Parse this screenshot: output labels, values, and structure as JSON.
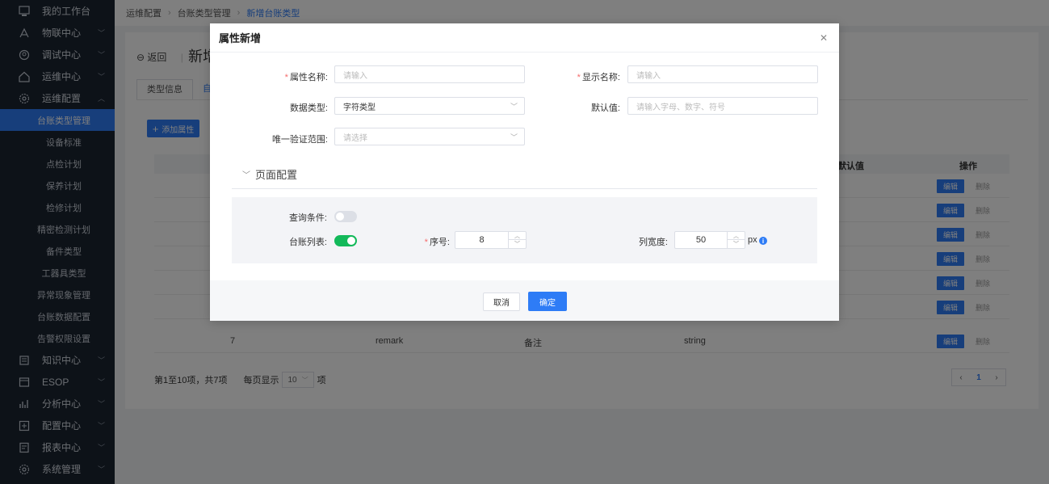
{
  "sidebar": {
    "groups_top": [
      {
        "label": "我的工作台",
        "icon": "monitor-icon",
        "chevron": false
      },
      {
        "label": "物联中心",
        "icon": "signal-icon",
        "chevron": true
      },
      {
        "label": "调试中心",
        "icon": "debug-icon",
        "chevron": true
      },
      {
        "label": "运维中心",
        "icon": "home-icon",
        "chevron": true
      },
      {
        "label": "运维配置",
        "icon": "gear-icon",
        "chevron": true,
        "expanded": true
      }
    ],
    "sub_items": [
      {
        "label": "台账类型管理",
        "active": true
      },
      {
        "label": "设备标准"
      },
      {
        "label": "点检计划"
      },
      {
        "label": "保养计划"
      },
      {
        "label": "检修计划"
      },
      {
        "label": "精密检测计划"
      },
      {
        "label": "备件类型"
      },
      {
        "label": "工器具类型"
      },
      {
        "label": "异常现象管理"
      },
      {
        "label": "台账数据配置"
      },
      {
        "label": "告警权限设置"
      }
    ],
    "groups_bottom": [
      {
        "label": "知识中心",
        "icon": "book-icon"
      },
      {
        "label": "ESOP",
        "icon": "esop-icon"
      },
      {
        "label": "分析中心",
        "icon": "chart-icon"
      },
      {
        "label": "配置中心",
        "icon": "config-icon"
      },
      {
        "label": "报表中心",
        "icon": "report-icon"
      },
      {
        "label": "系统管理",
        "icon": "settings-icon"
      }
    ]
  },
  "breadcrumb": [
    "运维配置",
    "台账类型管理",
    "新增台账类型"
  ],
  "page": {
    "back_label": "返回",
    "title_partial": "新增",
    "tabs": [
      "类型信息",
      "自"
    ],
    "add_button": "添加属性",
    "table_headers": {
      "default": "默认值",
      "ops": "操作"
    },
    "visible_row": {
      "index": "7",
      "code": "remark",
      "name": "备注",
      "type": "string"
    },
    "op_edit": "编辑",
    "op_delete": "删除",
    "footer_text": "第1至10项，共7项",
    "page_size_label": "每页显示",
    "page_size": "10",
    "page_size_unit": "项",
    "current_page": "1"
  },
  "modal": {
    "title": "属性新增",
    "fields": {
      "attr_name": {
        "label": "属性名称:",
        "placeholder": "请输入",
        "required": true
      },
      "display_name": {
        "label": "显示名称:",
        "placeholder": "请输入",
        "required": true
      },
      "data_type": {
        "label": "数据类型:",
        "value": "字符类型"
      },
      "default_value": {
        "label": "默认值:",
        "placeholder": "请输入字母、数字、符号"
      },
      "unique_scope": {
        "label": "唯一验证范围:",
        "placeholder": "请选择"
      }
    },
    "section": "页面配置",
    "config": {
      "query_label": "查询条件:",
      "query_on": false,
      "list_label": "台账列表:",
      "list_on": true,
      "order_label": "序号:",
      "order_value": "8",
      "width_label": "列宽度:",
      "width_value": "50",
      "width_unit": "px"
    },
    "cancel": "取消",
    "confirm": "确定"
  },
  "colors": {
    "primary": "#2e7cf6",
    "sidebar_bg": "#1b2431",
    "switch_on": "#13b95a",
    "required": "#f56c6c"
  }
}
